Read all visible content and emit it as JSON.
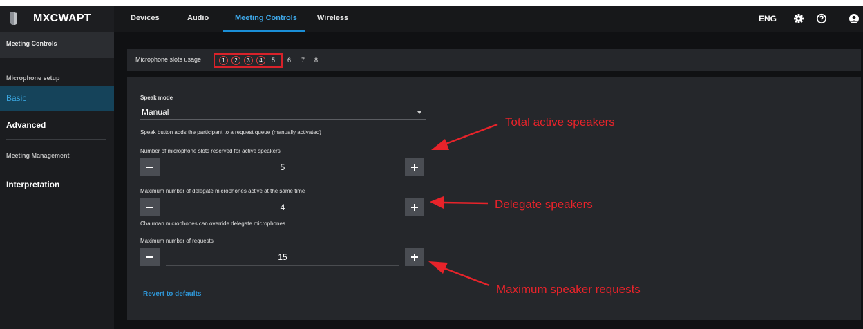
{
  "header": {
    "app_name": "MXCWAPT",
    "tabs": [
      {
        "label": "Devices"
      },
      {
        "label": "Audio"
      },
      {
        "label": "Meeting Controls"
      },
      {
        "label": "Wireless"
      }
    ],
    "language": "ENG",
    "icons": [
      "gear-icon",
      "help-icon",
      "user-icon"
    ]
  },
  "sidebar": {
    "section1": "Meeting Controls",
    "section2": "Microphone setup",
    "items": [
      {
        "label": "Basic"
      },
      {
        "label": "Advanced"
      }
    ],
    "section3": "Meeting Management",
    "item3": "Interpretation"
  },
  "slots": {
    "label": "Microphone slots usage",
    "used": [
      "1",
      "2",
      "3",
      "4"
    ],
    "numbers": [
      "5",
      "6",
      "7",
      "8"
    ]
  },
  "form": {
    "speak_mode_label": "Speak mode",
    "speak_mode_value": "Manual",
    "speak_mode_help": "Speak button adds the participant to a request queue (manually activated)",
    "slots_reserved_label": "Number of microphone slots reserved for active speakers",
    "slots_reserved_value": "5",
    "max_delegate_label": "Maximum number of delegate microphones active at the same time",
    "max_delegate_value": "4",
    "chairman_note": "Chairman microphones can override delegate microphones",
    "max_requests_label": "Maximum number of requests",
    "max_requests_value": "15",
    "revert": "Revert to defaults"
  },
  "annotations": {
    "total": "Total active speakers",
    "delegate": "Delegate speakers",
    "requests": "Maximum speaker requests"
  },
  "colors": {
    "accent": "#1a8ed6",
    "annotation_red": "#e8232a",
    "panel": "#25272b"
  }
}
